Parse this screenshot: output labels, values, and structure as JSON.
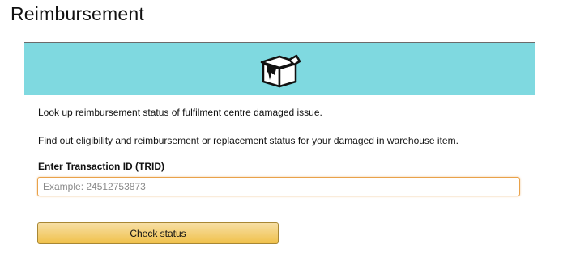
{
  "page": {
    "title": "Reimbursement"
  },
  "banner": {
    "icon": "damaged-box-icon",
    "color": "#7fd9e0"
  },
  "content": {
    "line1": "Look up reimbursement status of fulfilment centre damaged issue.",
    "line2": "Find out eligibility and reimbursement or replacement status for your damaged in warehouse item."
  },
  "form": {
    "label": "Enter Transaction ID (TRID)",
    "input_value": "",
    "input_placeholder": "Example: 24512753873",
    "button_label": "Check status"
  },
  "colors": {
    "input_focus_border": "#e9a24a",
    "button_top": "#f7dfa5",
    "button_bottom": "#f0c14b"
  }
}
